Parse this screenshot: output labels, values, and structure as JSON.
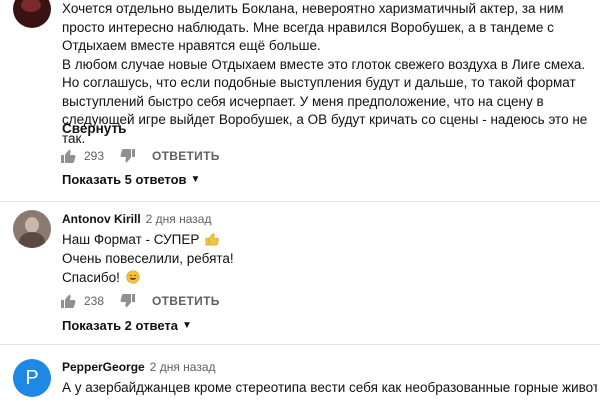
{
  "comment1": {
    "paragraph1": "Хочется отдельно выделить Боклана, невероятно харизматичный актер, за ним просто интересно наблюдать. Мне всегда нравился Воробушек, а в тандеме с Отдыхаем вместе нравятся ещё больше.",
    "paragraph2": "В любом случае новые Отдыхаем вместе это глоток свежего воздуха в Лиге смеха. Но соглашусь, что если подобные выступления будут и дальше, то такой формат выступлений быстро себя исчерпает. У меня предположение, что на сцену в следующей игре выйдет Воробушек, а ОВ будут кричать со сцены - надеюсь это не так.",
    "collapse": "Свернуть",
    "likes": "293",
    "reply": "ОТВЕТИТЬ",
    "show_replies": "Показать 5 ответов"
  },
  "comment2": {
    "author": "Antonov Kirill",
    "time": "2 дня назад",
    "line1": "Наш Формат - СУПЕР",
    "line2": "Очень повеселили, ребята!",
    "line3": "Спасибо!",
    "likes": "238",
    "reply": "ОТВЕТИТЬ",
    "show_replies": "Показать 2 ответа"
  },
  "comment3": {
    "author": "PepperGeorge",
    "time": "2 дня назад",
    "avatar_letter": "P",
    "line1": "А у азербайджанцев кроме стереотипа вести себя как необразованные горные животные"
  },
  "icons": {
    "like": "thumb-up-icon",
    "dislike": "thumb-down-icon",
    "expand": "chevron-down-icon"
  }
}
